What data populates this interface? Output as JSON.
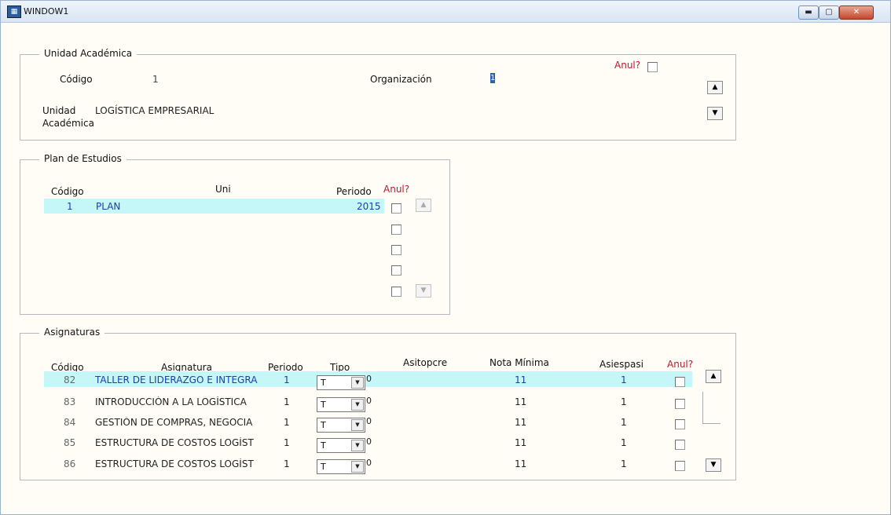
{
  "window": {
    "title": "WINDOW1",
    "min_label": "▬",
    "max_label": "▢",
    "close_label": "✕"
  },
  "unidad": {
    "legend": "Unidad Académica",
    "codigo_label": "Código",
    "codigo_value": "1",
    "organizacion_label": "Organización",
    "organizacion_value": "1",
    "anul_label": "Anul?",
    "unidad_label_1": "Unidad",
    "unidad_label_2": "Académica",
    "unidad_value": "LOGÍSTICA EMPRESARIAL"
  },
  "plan": {
    "legend": "Plan de Estudios",
    "headers": {
      "codigo": "Código",
      "uni": "Uni",
      "periodo": "Periodo",
      "anul": "Anul?"
    },
    "rows": [
      {
        "codigo": "1",
        "uni": "PLAN",
        "periodo": "2015"
      }
    ]
  },
  "asignaturas": {
    "legend": "Asignaturas",
    "headers": {
      "codigo": "Código",
      "asignatura": "Asignatura",
      "periodo": "Periodo",
      "tipo": "Tipo",
      "asitopcre": "Asitopcre",
      "nota": "Nota Mínima",
      "asiespasi": "Asiespasi",
      "anul": "Anul?"
    },
    "rows": [
      {
        "codigo": "82",
        "asignatura": "TALLER DE LIDERAZGO E INTEGRA",
        "periodo": "1",
        "tipo": "T",
        "asitopcre": "0",
        "nota": "11",
        "asiespasi": "1"
      },
      {
        "codigo": "83",
        "asignatura": "INTRODUCCIÓN A LA LOGÍSTICA",
        "periodo": "1",
        "tipo": "T",
        "asitopcre": "0",
        "nota": "11",
        "asiespasi": "1"
      },
      {
        "codigo": "84",
        "asignatura": "GESTIÓN DE COMPRAS, NEGOCIA",
        "periodo": "1",
        "tipo": "T",
        "asitopcre": "0",
        "nota": "11",
        "asiespasi": "1"
      },
      {
        "codigo": "85",
        "asignatura": "ESTRUCTURA DE COSTOS LOGÍST",
        "periodo": "1",
        "tipo": "T",
        "asitopcre": "0",
        "nota": "11",
        "asiespasi": "1"
      },
      {
        "codigo": "86",
        "asignatura": "ESTRUCTURA DE COSTOS LOGÍST",
        "periodo": "1",
        "tipo": "T",
        "asitopcre": "0",
        "nota": "11",
        "asiespasi": "1"
      }
    ]
  }
}
